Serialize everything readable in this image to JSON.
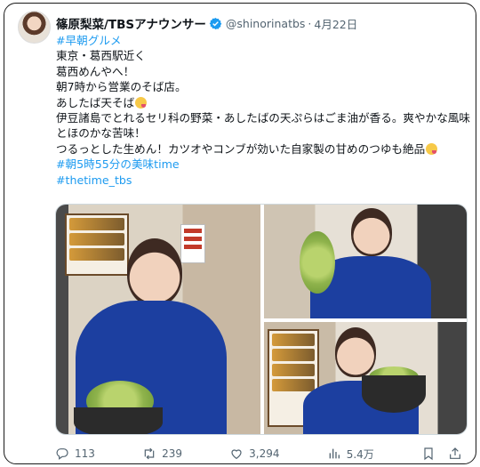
{
  "tweet": {
    "author_name": "篠原梨菜/TBSアナウンサー",
    "handle": "@shinorinatbs",
    "separator": "·",
    "date": "4月22日",
    "lines": [
      "#早朝グルメ",
      "東京・葛西駅近く",
      "葛西めんやへ！",
      "朝7時から営業のそば店。",
      "あしたば天そば",
      "伊豆諸島でとれるセリ科の野菜・あしたばの天ぷらはごま油が香る。爽やかな風味とほのかな苦味！",
      "つるっとした生めん！カツオやコンブが効いた自家製の甘めのつゆも絶品",
      "#朝5時55分の美味time",
      "#thetime_tbs"
    ]
  },
  "icons": {
    "verified": "verified-badge-icon",
    "avatar": "profile-avatar",
    "emoji": "savoring-food-emoji"
  },
  "actions": {
    "replies": "113",
    "retweets": "239",
    "likes": "3,294",
    "views": "5.4万"
  },
  "colors": {
    "link": "#1d9bf0",
    "verified": "#1d9bf0",
    "muted": "#536471"
  }
}
